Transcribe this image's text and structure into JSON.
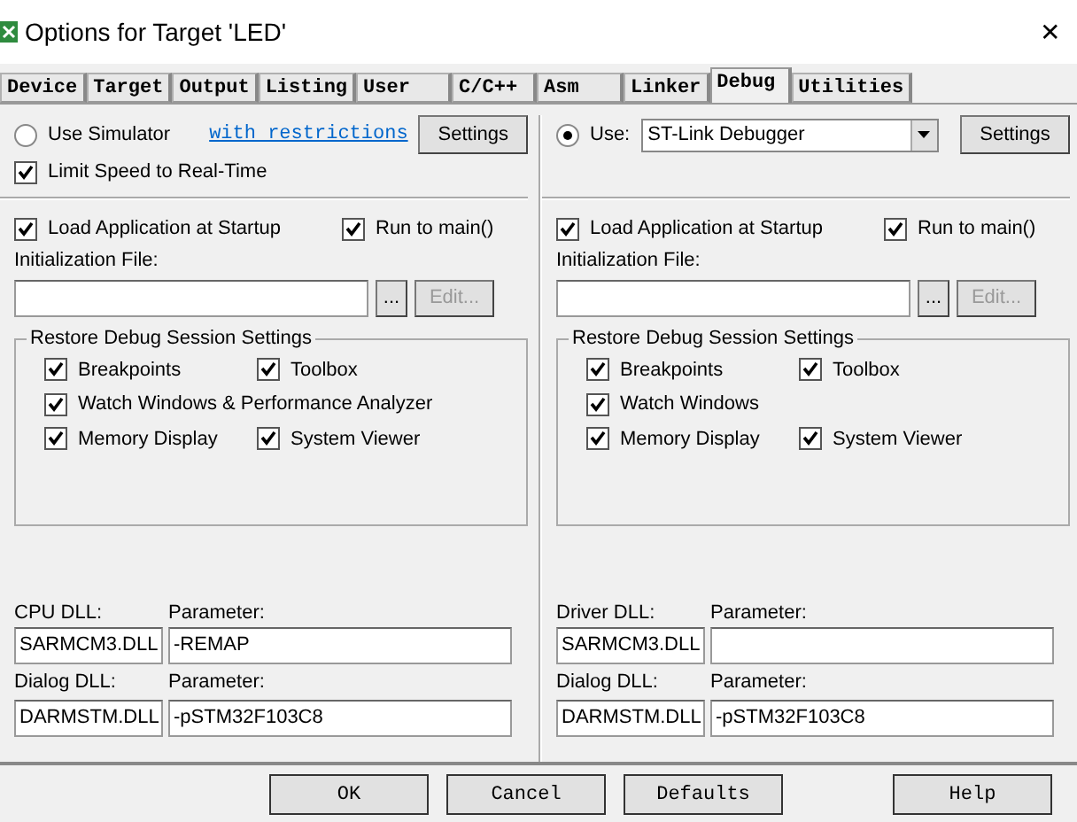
{
  "window": {
    "title": "Options for Target 'LED'",
    "close": "✕"
  },
  "tabs": [
    {
      "label": "Device",
      "selected": false
    },
    {
      "label": "Target",
      "selected": false
    },
    {
      "label": "Output",
      "selected": false
    },
    {
      "label": "Listing",
      "selected": false
    },
    {
      "label": "User",
      "selected": false
    },
    {
      "label": "C/C++",
      "selected": false
    },
    {
      "label": "Asm",
      "selected": false
    },
    {
      "label": "Linker",
      "selected": false
    },
    {
      "label": "Debug",
      "selected": true
    },
    {
      "label": "Utilities",
      "selected": false
    }
  ],
  "panes": [
    {
      "source": {
        "kind": "simulator",
        "label": "Use Simulator",
        "selected": false,
        "link": "with restrictions",
        "settings": "Settings"
      },
      "limit_speed": {
        "label": "Limit Speed to Real-Time",
        "checked": true
      },
      "load": {
        "label": "Load Application at Startup",
        "checked": true
      },
      "run_to_main": {
        "label": "Run to main()",
        "checked": true
      },
      "init_file": {
        "label": "Initialization File:",
        "browse": "...",
        "edit": "Edit...",
        "edit_disabled": true
      },
      "restore": {
        "title": "Restore Debug Session Settings",
        "rows": [
          [
            {
              "label": "Breakpoints",
              "checked": true
            },
            {
              "label": "Toolbox",
              "checked": true
            }
          ],
          [
            {
              "label": "Watch Windows & Performance Analyzer",
              "checked": true
            }
          ],
          [
            {
              "label": "Memory Display",
              "checked": true
            },
            {
              "label": "System Viewer",
              "checked": true
            }
          ]
        ]
      },
      "dlls": [
        {
          "label": "CPU DLL:",
          "value": "SARMCM3.DLL",
          "param_label": "Parameter:",
          "param_value": "-REMAP"
        },
        {
          "label": "Dialog DLL:",
          "value": "DARMSTM.DLL",
          "param_label": "Parameter:",
          "param_value": "-pSTM32F103C8"
        }
      ]
    },
    {
      "source": {
        "kind": "debugger",
        "label": "Use:",
        "selected": true,
        "value": "ST-Link Debugger",
        "settings": "Settings"
      },
      "load": {
        "label": "Load Application at Startup",
        "checked": true
      },
      "run_to_main": {
        "label": "Run to main()",
        "checked": true
      },
      "init_file": {
        "label": "Initialization File:",
        "browse": "...",
        "edit": "Edit...",
        "edit_disabled": true
      },
      "restore": {
        "title": "Restore Debug Session Settings",
        "rows": [
          [
            {
              "label": "Breakpoints",
              "checked": true
            },
            {
              "label": "Toolbox",
              "checked": true
            }
          ],
          [
            {
              "label": "Watch Windows",
              "checked": true
            }
          ],
          [
            {
              "label": "Memory Display",
              "checked": true
            },
            {
              "label": "System Viewer",
              "checked": true
            }
          ]
        ]
      },
      "dlls": [
        {
          "label": "Driver DLL:",
          "value": "SARMCM3.DLL",
          "param_label": "Parameter:"
        },
        {
          "label": "Dialog DLL:",
          "value": "DARMSTM.DLL",
          "param_label": "Parameter:",
          "param_value": "-pSTM32F103C8"
        }
      ]
    }
  ],
  "buttons": [
    {
      "label": "OK"
    },
    {
      "label": "Cancel"
    },
    {
      "label": "Defaults"
    },
    {
      "label": "Help"
    }
  ]
}
